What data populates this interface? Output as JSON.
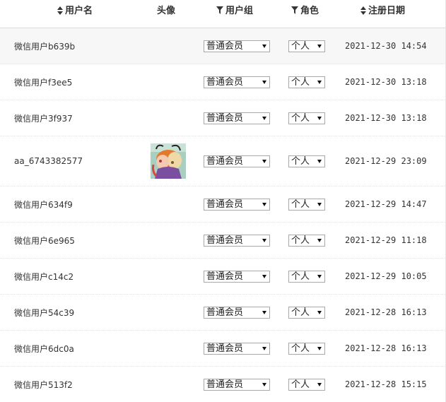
{
  "columns": {
    "username": "用户名",
    "avatar": "头像",
    "group": "用户组",
    "role": "角色",
    "register_date": "注册日期"
  },
  "icons": {
    "sort": "sort-icon",
    "filter": "filter-icon"
  },
  "rows": [
    {
      "username": "微信用户b639b",
      "group": "普通会员",
      "role": "个人",
      "date": "2021-12-30 14:54"
    },
    {
      "username": "微信用户f3ee5",
      "group": "普通会员",
      "role": "个人",
      "date": "2021-12-30 13:18"
    },
    {
      "username": "微信用户3f937",
      "group": "普通会员",
      "role": "个人",
      "date": "2021-12-30 13:18"
    },
    {
      "username": "aa_6743382577",
      "group": "普通会员",
      "role": "个人",
      "date": "2021-12-29 23:09"
    },
    {
      "username": "微信用户634f9",
      "group": "普通会员",
      "role": "个人",
      "date": "2021-12-29 14:47"
    },
    {
      "username": "微信用户6e965",
      "group": "普通会员",
      "role": "个人",
      "date": "2021-12-29 11:18"
    },
    {
      "username": "微信用户c14c2",
      "group": "普通会员",
      "role": "个人",
      "date": "2021-12-29 10:05"
    },
    {
      "username": "微信用户54c39",
      "group": "普通会员",
      "role": "个人",
      "date": "2021-12-28 16:13"
    },
    {
      "username": "微信用户6dc0a",
      "group": "普通会员",
      "role": "个人",
      "date": "2021-12-28 16:13"
    },
    {
      "username": "微信用户513f2",
      "group": "普通会员",
      "role": "个人",
      "date": "2021-12-28 15:15"
    }
  ]
}
